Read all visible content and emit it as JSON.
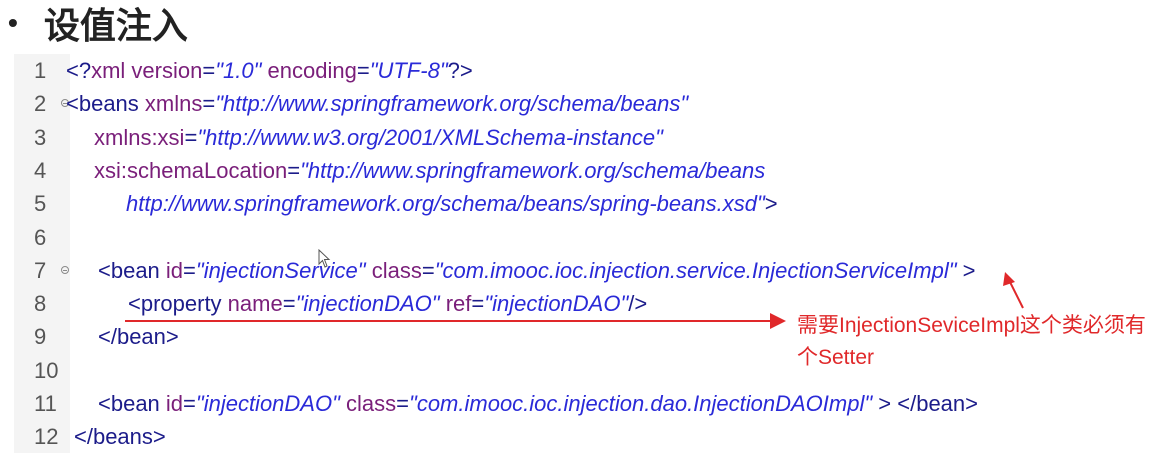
{
  "slide": {
    "bullet": "•",
    "title": "设值注入"
  },
  "editor": {
    "lines": [
      {
        "n": "1",
        "fold": false,
        "indent": 52,
        "parts": [
          [
            "t",
            "<?"
          ],
          [
            "a",
            "xml version"
          ],
          [
            "t",
            "="
          ],
          [
            "v",
            "\"1.0\""
          ],
          [
            "t",
            " "
          ],
          [
            "a",
            "encoding"
          ],
          [
            "t",
            "="
          ],
          [
            "v",
            "\"UTF-8\""
          ],
          [
            "t",
            "?>"
          ]
        ]
      },
      {
        "n": "2",
        "fold": true,
        "indent": 52,
        "parts": [
          [
            "t",
            "<beans "
          ],
          [
            "a",
            "xmlns"
          ],
          [
            "t",
            "="
          ],
          [
            "v",
            "\"http://www.springframework.org/schema/beans\""
          ]
        ]
      },
      {
        "n": "3",
        "fold": false,
        "indent": 80,
        "parts": [
          [
            "a",
            "xmlns:xsi"
          ],
          [
            "t",
            "="
          ],
          [
            "v",
            "\"http://www.w3.org/2001/XMLSchema-instance\""
          ]
        ]
      },
      {
        "n": "4",
        "fold": false,
        "indent": 80,
        "parts": [
          [
            "a",
            "xsi:schemaLocation"
          ],
          [
            "t",
            "="
          ],
          [
            "v",
            "\"http://www.springframework.org/schema/beans"
          ]
        ]
      },
      {
        "n": "5",
        "fold": false,
        "indent": 112,
        "parts": [
          [
            "v",
            "http://www.springframework.org/schema/beans/spring-beans.xsd\""
          ],
          [
            "t",
            ">"
          ]
        ]
      },
      {
        "n": "6",
        "fold": false,
        "indent": 52,
        "parts": []
      },
      {
        "n": "7",
        "fold": true,
        "indent": 84,
        "parts": [
          [
            "t",
            "<bean "
          ],
          [
            "a",
            "id"
          ],
          [
            "t",
            "="
          ],
          [
            "v",
            "\"injectionService\""
          ],
          [
            "t",
            " "
          ],
          [
            "a",
            "class"
          ],
          [
            "t",
            "="
          ],
          [
            "v",
            "\"com.imooc.ioc.injection.service.InjectionServiceImpl\""
          ],
          [
            "t",
            " >"
          ]
        ]
      },
      {
        "n": "8",
        "fold": false,
        "indent": 114,
        "parts": [
          [
            "t",
            "<property "
          ],
          [
            "a",
            "name"
          ],
          [
            "t",
            "="
          ],
          [
            "v",
            "\"injectionDAO\""
          ],
          [
            "t",
            " "
          ],
          [
            "a",
            "ref"
          ],
          [
            "t",
            "="
          ],
          [
            "v",
            "\"injectionDAO\""
          ],
          [
            "t",
            "/>"
          ]
        ]
      },
      {
        "n": "9",
        "fold": false,
        "indent": 84,
        "parts": [
          [
            "t",
            "</bean>"
          ]
        ]
      },
      {
        "n": "10",
        "fold": false,
        "indent": 52,
        "parts": []
      },
      {
        "n": "11",
        "fold": false,
        "indent": 84,
        "parts": [
          [
            "t",
            "<bean "
          ],
          [
            "a",
            "id"
          ],
          [
            "t",
            "="
          ],
          [
            "v",
            "\"injectionDAO\""
          ],
          [
            "t",
            " "
          ],
          [
            "a",
            "class"
          ],
          [
            "t",
            "="
          ],
          [
            "v",
            "\"com.imooc.ioc.injection.dao.InjectionDAOImpl\""
          ],
          [
            "t",
            " > </bean>"
          ]
        ]
      },
      {
        "n": "12",
        "fold": false,
        "indent": 60,
        "parts": [
          [
            "t",
            "</beans>"
          ]
        ]
      }
    ]
  },
  "annotation": {
    "text": "需要InjectionSeviceImpl这个类必须有个Setter",
    "color": "#e0282a"
  },
  "colors": {
    "tag": "#1c1c8a",
    "attribute": "#7a1f7a",
    "value": "#2a2ad8",
    "gutter": "#f4f4f4"
  }
}
